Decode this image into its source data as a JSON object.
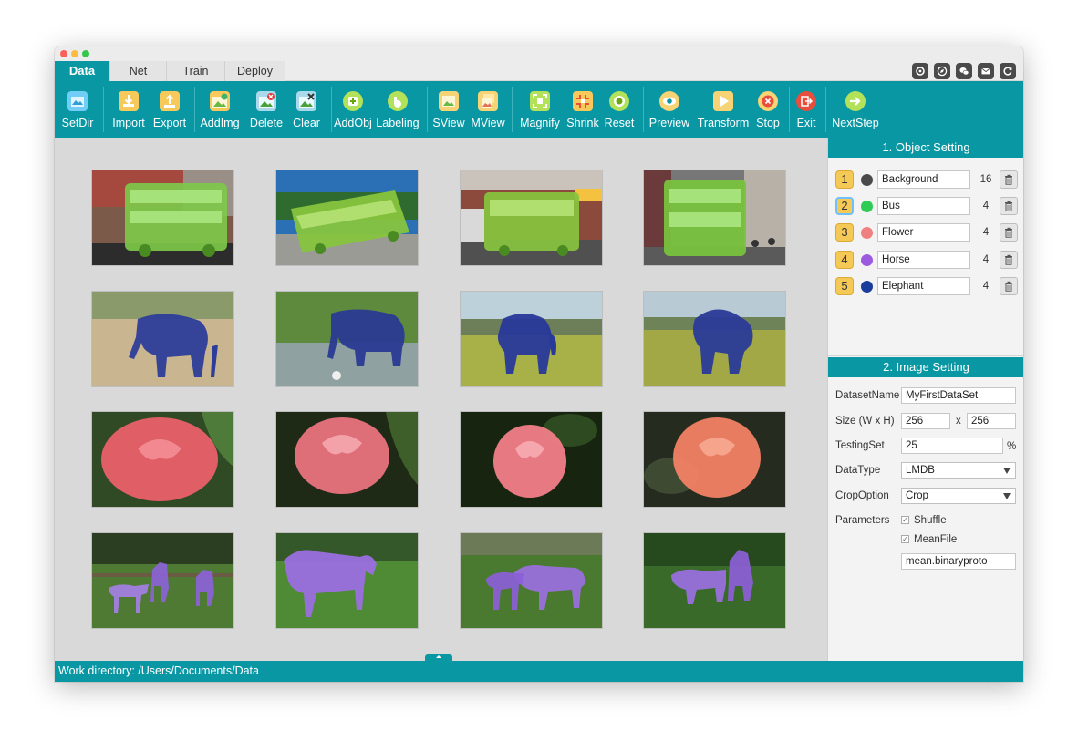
{
  "tabs": [
    {
      "label": "Data"
    },
    {
      "label": "Net"
    },
    {
      "label": "Train"
    },
    {
      "label": "Deploy"
    }
  ],
  "top_icons": [
    "settings-icon",
    "compass-icon",
    "wechat-icon",
    "mail-icon",
    "refresh-icon"
  ],
  "toolbar": {
    "setdir": "SetDir",
    "import": "Import",
    "export": "Export",
    "addimg": "AddImg",
    "delete": "Delete",
    "clear": "Clear",
    "addobj": "AddObj",
    "labeling": "Labeling",
    "sview": "SView",
    "mview": "MView",
    "magnify": "Magnify",
    "shrink": "Shrink",
    "reset": "Reset",
    "preview": "Preview",
    "transform": "Transform",
    "stop": "Stop",
    "exit": "Exit",
    "nextstep": "NextStep"
  },
  "colors": {
    "accent": "#0a97a4",
    "background_class": "#4a4a4a",
    "bus": "#2ecc54",
    "flower": "#ef8080",
    "horse": "#9b5be0",
    "elephant": "#1a3c9c"
  },
  "object_setting": {
    "title": "1. Object Setting",
    "objects": [
      {
        "num": "1",
        "name": "Background",
        "count": "16",
        "color": "#4a4a4a"
      },
      {
        "num": "2",
        "name": "Bus",
        "count": "4",
        "color": "#2ecc54"
      },
      {
        "num": "3",
        "name": "Flower",
        "count": "4",
        "color": "#ef8080"
      },
      {
        "num": "4",
        "name": "Horse",
        "count": "4",
        "color": "#9b5be0"
      },
      {
        "num": "5",
        "name": "Elephant",
        "count": "4",
        "color": "#1a3c9c"
      }
    ]
  },
  "image_setting": {
    "title": "2. Image Setting",
    "dataset_label": "DatasetName",
    "dataset_value": "MyFirstDataSet",
    "size_label": "Size (W x H)",
    "size_w": "256",
    "size_x": "x",
    "size_h": "256",
    "testing_label": "TestingSet",
    "testing_value": "25",
    "testing_unit": "%",
    "datatype_label": "DataType",
    "datatype_value": "LMDB",
    "crop_label": "CropOption",
    "crop_value": "Crop",
    "params_label": "Parameters",
    "shuffle_label": "Shuffle",
    "meanfile_label": "MeanFile",
    "meanfile_value": "mean.binaryproto"
  },
  "status": {
    "text": "Work directory: /Users/Documents/Data"
  }
}
